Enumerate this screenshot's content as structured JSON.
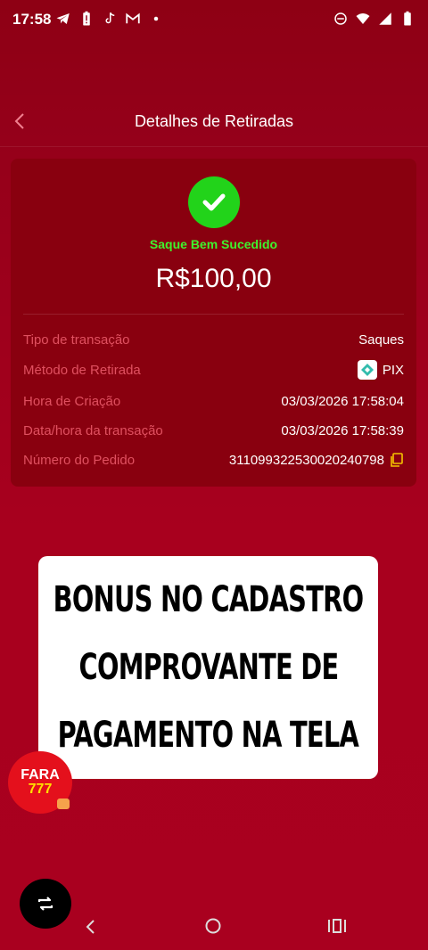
{
  "status_bar": {
    "time": "17:58",
    "left_icons": [
      "telegram-icon",
      "battery-alert-icon",
      "tiktok-icon",
      "gmail-icon",
      "dot-icon"
    ],
    "right_icons": [
      "do-not-disturb-icon",
      "wifi-icon",
      "signal-icon",
      "battery-icon"
    ]
  },
  "header": {
    "back_icon": "chevron-left-icon",
    "title": "Detalhes de Retiradas"
  },
  "card": {
    "status_icon": "check-icon",
    "status_text": "Saque Bem Sucedido",
    "amount": "R$100,00",
    "rows": [
      {
        "label": "Tipo de transação",
        "value": "Saques"
      },
      {
        "label": "Método de Retirada",
        "value": "PIX"
      },
      {
        "label": "Hora de Criação",
        "value": "03/03/2026 17:58:04"
      },
      {
        "label": "Data/hora da transação",
        "value": "03/03/2026 17:58:39"
      },
      {
        "label": "Número do Pedido",
        "value": "311099322530020240798"
      }
    ]
  },
  "promo": {
    "lines": [
      "BONUS NO CADASTRO",
      "COMPROVANTE DE",
      "PAGAMENTO NA TELA"
    ]
  },
  "floating_logo": {
    "line1": "FARA",
    "line2": "777"
  },
  "colors": {
    "background": "#a8001e",
    "card": "#89000f",
    "success": "#22d31a",
    "success_text": "#3ef52d",
    "label": "#e05060",
    "copy_icon": "#f5c400"
  }
}
